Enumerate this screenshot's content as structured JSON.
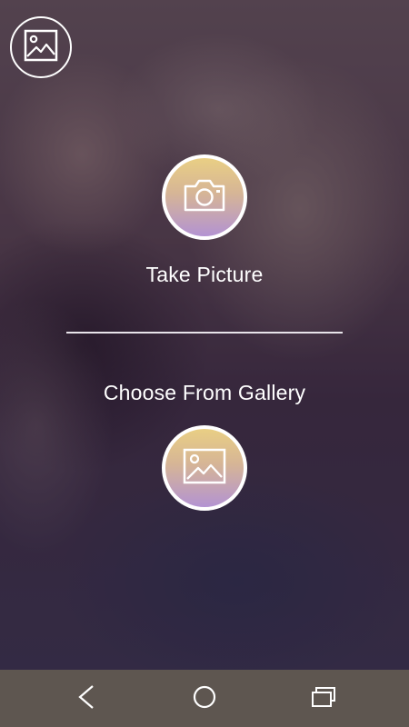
{
  "actions": {
    "take_picture_label": "Take Picture",
    "choose_gallery_label": "Choose From Gallery"
  },
  "icons": {
    "corner": "image-icon",
    "camera": "camera-icon",
    "gallery": "image-icon",
    "nav_back": "back-icon",
    "nav_home": "home-icon",
    "nav_recent": "recent-apps-icon"
  },
  "colors": {
    "button_gradient_top": "#e9cf84",
    "button_gradient_bottom": "#b393d2",
    "navbar": "#5e5650",
    "text": "#ffffff"
  }
}
